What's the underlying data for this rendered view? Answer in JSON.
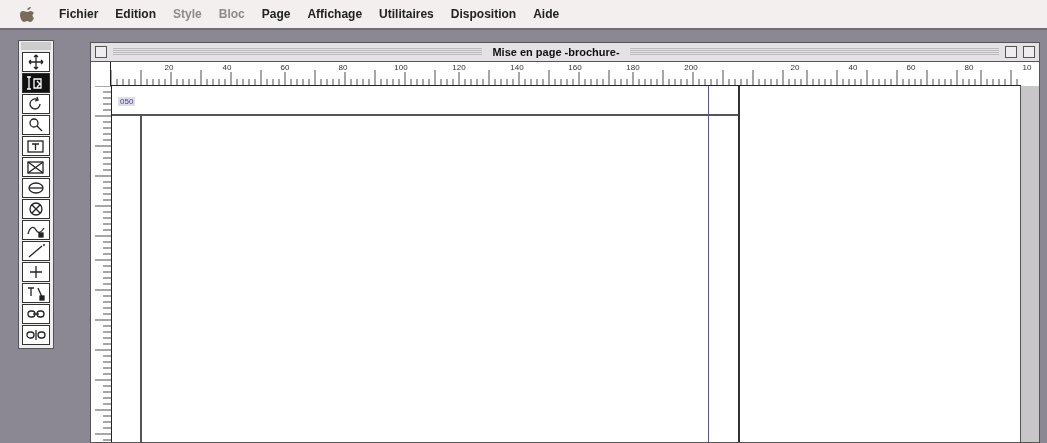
{
  "menu_bar": {
    "items": [
      {
        "label": "Fichier",
        "disabled": false
      },
      {
        "label": "Edition",
        "disabled": false
      },
      {
        "label": "Style",
        "disabled": true
      },
      {
        "label": "Bloc",
        "disabled": true
      },
      {
        "label": "Page",
        "disabled": false
      },
      {
        "label": "Affichage",
        "disabled": false
      },
      {
        "label": "Utilitaires",
        "disabled": false
      },
      {
        "label": "Disposition",
        "disabled": false
      },
      {
        "label": "Aide",
        "disabled": false
      }
    ]
  },
  "tools": [
    {
      "kind": "item",
      "selected": false
    },
    {
      "kind": "content",
      "selected": true
    },
    {
      "kind": "rotate",
      "selected": false
    },
    {
      "kind": "zoom",
      "selected": false
    },
    {
      "kind": "textbox",
      "selected": false
    },
    {
      "kind": "picturebox",
      "selected": false
    },
    {
      "kind": "oval",
      "selected": false
    },
    {
      "kind": "circle",
      "selected": false
    },
    {
      "kind": "freehand",
      "selected": false
    },
    {
      "kind": "line",
      "selected": false
    },
    {
      "kind": "orthogonal",
      "selected": false
    },
    {
      "kind": "textpath",
      "selected": false
    },
    {
      "kind": "link",
      "selected": false
    },
    {
      "kind": "unlink",
      "selected": false
    }
  ],
  "document": {
    "title": "Mise en page -brochure-",
    "ruler": {
      "segments": [
        {
          "labels": [
            "20",
            "40",
            "60",
            "80",
            "100",
            "120",
            "140",
            "160",
            "180",
            "200"
          ]
        },
        {
          "labels": [
            "20",
            "40",
            "60",
            "80",
            "10"
          ]
        }
      ]
    },
    "page_number": "050"
  }
}
